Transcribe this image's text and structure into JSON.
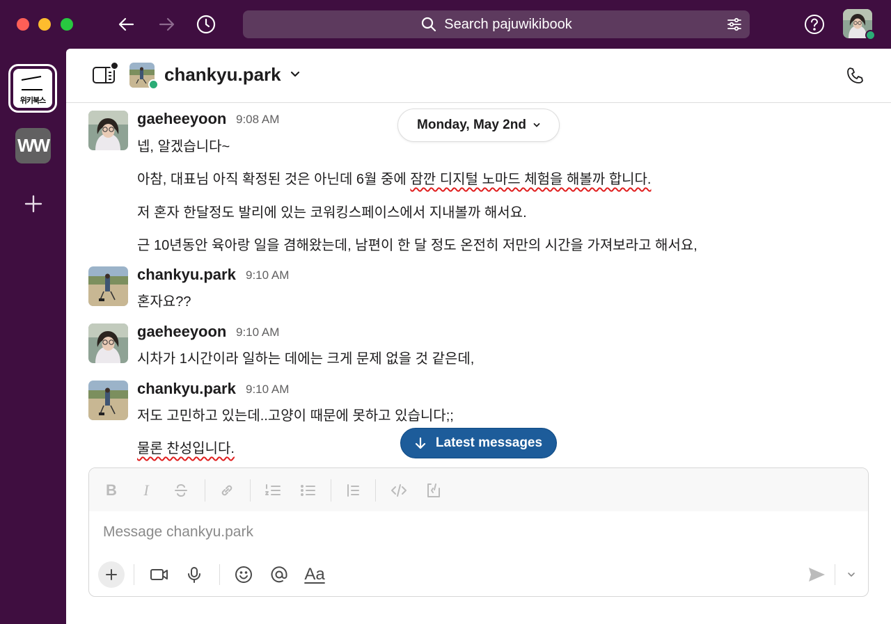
{
  "app": {
    "search_placeholder": "Search pajuwikibook"
  },
  "workspaces": [
    {
      "name": "위키북스",
      "active": true
    },
    {
      "name": "WW",
      "active": false
    }
  ],
  "channel": {
    "name": "chankyu.park"
  },
  "date_divider": "Monday, May 2nd",
  "messages": [
    {
      "author": "gaeheeyoon",
      "time": "9:08 AM",
      "lines": [
        "넵, 알겠습니다~",
        "아참, 대표님 아직 확정된 것은 아닌데 6월 중에 ",
        "잠깐 디지털 노마드 체험을 해볼까 합니다.",
        "저 혼자 한달정도 발리에 있는 코워킹스페이스에서 지내볼까 해서요.",
        "근 10년동안 육아랑 일을 겸해왔는데, 남편이 한 달 정도 온전히 저만의 시간을 가져보라고 해서요,"
      ]
    },
    {
      "author": "chankyu.park",
      "time": "9:10 AM",
      "lines": [
        "혼자요??"
      ]
    },
    {
      "author": "gaeheeyoon",
      "time": "9:10 AM",
      "lines": [
        "시차가 1시간이라 일하는 데에는 크게 문제 없을 것 같은데,"
      ]
    },
    {
      "author": "chankyu.park",
      "time": "9:10 AM",
      "lines": [
        "저도 고민하고 있는데..고양이 때문에 못하고 있습니다;;",
        "물론 찬성입니다."
      ]
    }
  ],
  "latest_messages_label": "Latest messages",
  "composer": {
    "placeholder": "Message chankyu.park",
    "format_bold": "B",
    "format_italic": "I",
    "text_style": "Aa"
  },
  "colors": {
    "aubergine": "#3f0e40",
    "accent_blue": "#1d5c9a",
    "presence_green": "#2bac76",
    "spell_red": "#e01e1e"
  }
}
